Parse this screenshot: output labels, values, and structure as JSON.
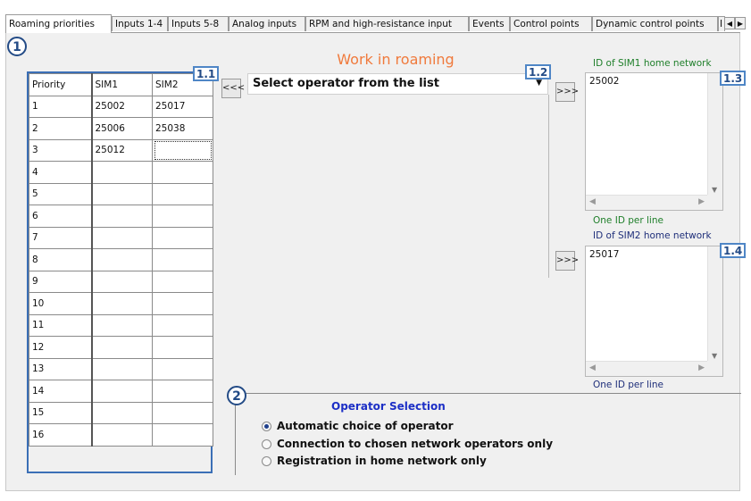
{
  "tabs": [
    {
      "label": "Roaming priorities",
      "active": true
    },
    {
      "label": "Inputs 1-4"
    },
    {
      "label": "Inputs 5-8"
    },
    {
      "label": "Analog inputs"
    },
    {
      "label": "RPM and high-resistance input"
    },
    {
      "label": "Events"
    },
    {
      "label": "Control points"
    },
    {
      "label": "Dynamic control points"
    },
    {
      "label": "I"
    }
  ],
  "section_numbers": {
    "s1": "1",
    "s2": "2"
  },
  "badges": {
    "b11": "1.1",
    "b12": "1.2",
    "b13": "1.3",
    "b14": "1.4"
  },
  "priority_table": {
    "headers": [
      "Priority",
      "SIM1",
      "SIM2"
    ],
    "rows": [
      [
        "1",
        "25002",
        "25017"
      ],
      [
        "2",
        "25006",
        "25038"
      ],
      [
        "3",
        "25012",
        ""
      ],
      [
        "4",
        "",
        ""
      ],
      [
        "5",
        "",
        ""
      ],
      [
        "6",
        "",
        ""
      ],
      [
        "7",
        "",
        ""
      ],
      [
        "8",
        "",
        ""
      ],
      [
        "9",
        "",
        ""
      ],
      [
        "10",
        "",
        ""
      ],
      [
        "11",
        "",
        ""
      ],
      [
        "12",
        "",
        ""
      ],
      [
        "13",
        "",
        ""
      ],
      [
        "14",
        "",
        ""
      ],
      [
        "15",
        "",
        ""
      ],
      [
        "16",
        "",
        ""
      ]
    ]
  },
  "roaming": {
    "title": "Work in roaming",
    "operator_select": "Select operator from the list",
    "left_arrow": "<<<",
    "right_arrow": ">>>"
  },
  "sim1_home": {
    "label": "ID of SIM1 home network",
    "value": "25002",
    "hint": "One ID per line"
  },
  "sim2_home": {
    "label": "ID of SIM2 home network",
    "value": "25017",
    "hint": "One ID per line"
  },
  "operator_selection": {
    "title": "Operator Selection",
    "options": [
      {
        "label": "Automatic choice of operator",
        "selected": true
      },
      {
        "label": "Connection to chosen network operators only",
        "selected": false
      },
      {
        "label": "Registration in home network only",
        "selected": false
      }
    ]
  },
  "colors": {
    "accent_orange": "#f07a3c",
    "accent_blue": "#1c2fc6",
    "hint_green": "#1f7f2a",
    "badge_border": "#4f86c6"
  }
}
